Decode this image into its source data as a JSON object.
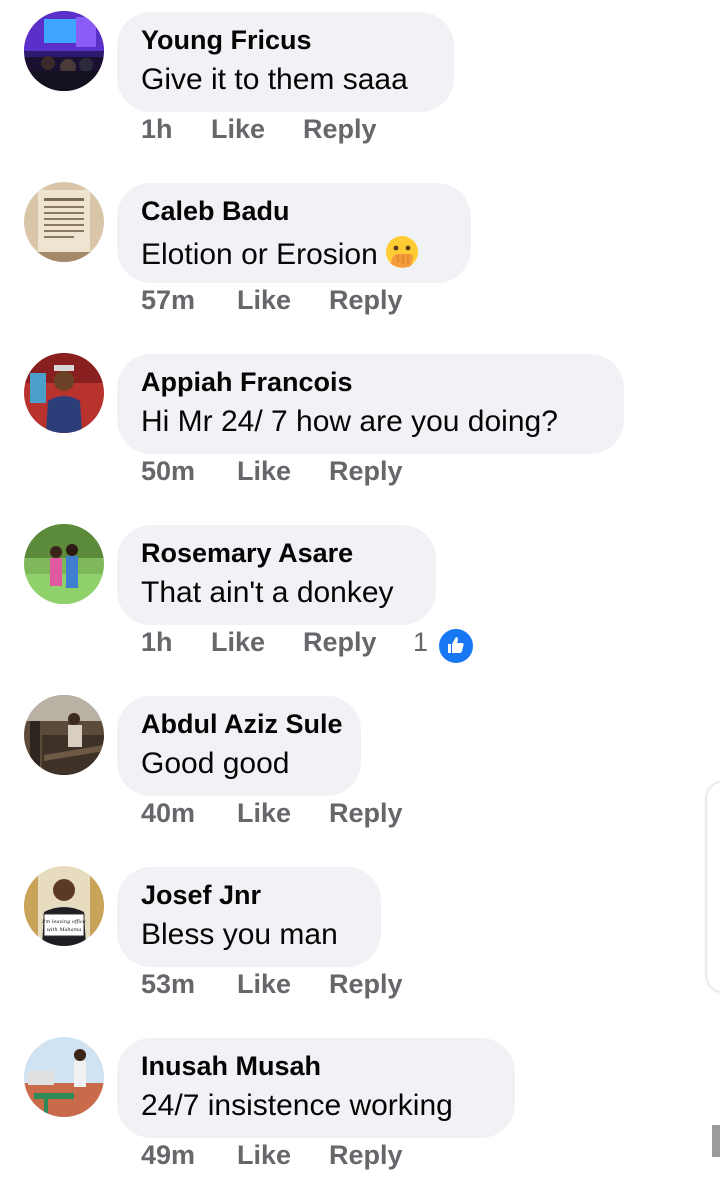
{
  "comments": [
    {
      "author": "Young Fricus",
      "text": "Give it to them saaa",
      "time": "1h",
      "like": "Like",
      "reply": "Reply",
      "avatar_icon": "stage-photo-icon"
    },
    {
      "author": "Caleb Badu",
      "text": "Elotion or Erosion",
      "emoji": "hand-over-mouth-emoji",
      "time": "57m",
      "like": "Like",
      "reply": "Reply",
      "avatar_icon": "prayer-plaque-icon"
    },
    {
      "author": "Appiah Francois",
      "text": "Hi Mr 24/ 7 how are you doing?",
      "time": "50m",
      "like": "Like",
      "reply": "Reply",
      "avatar_icon": "man-in-jacket-icon"
    },
    {
      "author": "Rosemary Asare",
      "text": "That ain't a donkey",
      "time": "1h",
      "like": "Like",
      "reply": "Reply",
      "reaction_count": "1",
      "reaction_icon": "like-reaction-icon",
      "avatar_icon": "couple-outdoors-icon"
    },
    {
      "author": "Abdul Aziz Sule",
      "text": "Good good",
      "time": "40m",
      "like": "Like",
      "reply": "Reply",
      "avatar_icon": "workshop-photo-icon"
    },
    {
      "author": "Josef Jnr",
      "text": "Bless you man",
      "time": "53m",
      "like": "Like",
      "reply": "Reply",
      "avatar_icon": "man-holding-sign-icon"
    },
    {
      "author": "Inusah Musah",
      "text": "24/7 insistence working",
      "time": "49m",
      "like": "Like",
      "reply": "Reply",
      "avatar_icon": "outdoor-photo-icon"
    }
  ],
  "avatar_sign_text": "I'm leaving office with Mahama",
  "colors": {
    "bubble": "#f0f2f5",
    "author": "#050505",
    "meta": "#65676b",
    "like_blue": "#1877f2"
  }
}
